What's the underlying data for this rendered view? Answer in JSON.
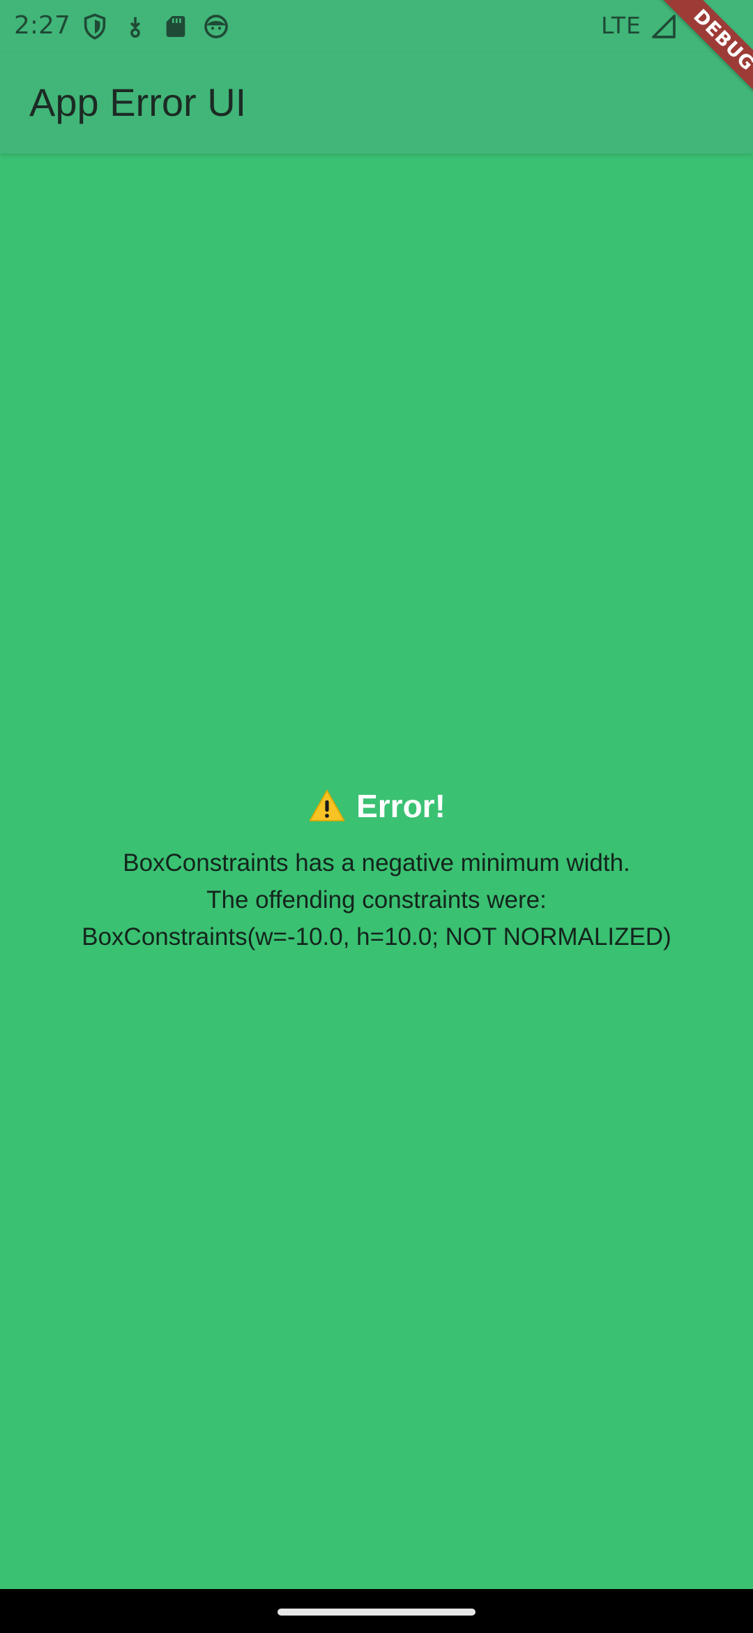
{
  "status_bar": {
    "time": "2:27",
    "network": "LTE",
    "icons": [
      "shield-icon",
      "download-icon",
      "sd-card-icon",
      "face-icon",
      "signal-icon"
    ]
  },
  "app_bar": {
    "title": "App Error UI"
  },
  "debug_banner": {
    "label": "DEBUG",
    "color": "#9d3b36"
  },
  "error": {
    "icon": "warning-icon",
    "title": "Error!",
    "message_lines": [
      "BoxConstraints has a negative minimum width.",
      "The offending constraints were:",
      "BoxConstraints(w=-10.0, h=10.0; NOT NORMALIZED)"
    ]
  },
  "colors": {
    "background": "#3ac172",
    "app_bar": "#41b678",
    "title_text": "#ffffff",
    "body_text": "#14241c"
  }
}
